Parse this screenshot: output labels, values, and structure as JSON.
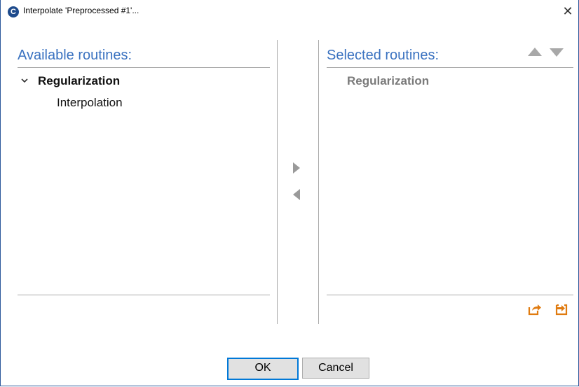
{
  "window": {
    "title": "Interpolate 'Preprocessed #1'...",
    "app_icon_letter": "C",
    "close_glyph": "✕"
  },
  "available": {
    "title": "Available routines:",
    "groups": [
      {
        "label": "Regularization",
        "expanded": true,
        "items": [
          "Interpolation"
        ]
      }
    ]
  },
  "selected": {
    "title": "Selected routines:",
    "groups": [
      {
        "label": "Regularization"
      }
    ]
  },
  "icons": {
    "add": "triangle-right-icon",
    "remove": "triangle-left-icon",
    "move_up": "triangle-up-icon",
    "move_down": "triangle-down-icon",
    "export": "export-icon",
    "import": "import-icon"
  },
  "buttons": {
    "ok": "OK",
    "cancel": "Cancel"
  },
  "colors": {
    "accent": "#3a72c0",
    "io_icon": "#e07b10",
    "default_border": "#0078d7"
  }
}
